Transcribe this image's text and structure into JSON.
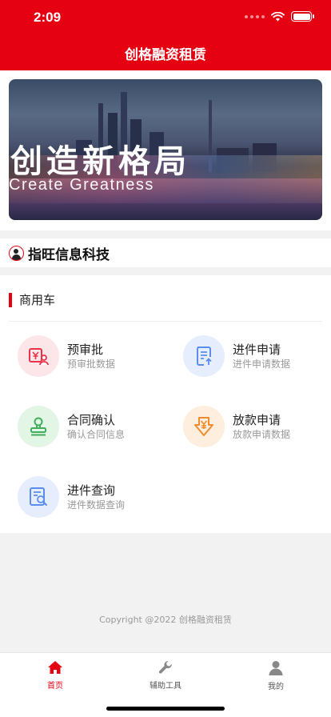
{
  "status_bar": {
    "time": "2:09"
  },
  "nav": {
    "title": "创格融资租赁"
  },
  "banner": {
    "title": "创造新格局",
    "subtitle": "Create Greatness"
  },
  "company": {
    "name": "指旺信息科技",
    "icon": "user-circle-icon"
  },
  "section": {
    "title": "商用车",
    "items": [
      {
        "title": "预审批",
        "subtitle": "预审批数据",
        "icon": "yuan-person-icon",
        "color": "#e8334a",
        "bg": "#fde6e8"
      },
      {
        "title": "进件申请",
        "subtitle": "进件申请数据",
        "icon": "document-upload-icon",
        "color": "#5b8dee",
        "bg": "#e6eefd"
      },
      {
        "title": "合同确认",
        "subtitle": "确认合同信息",
        "icon": "stamp-icon",
        "color": "#3fae58",
        "bg": "#e3f6e6"
      },
      {
        "title": "放款申请",
        "subtitle": "放款申请数据",
        "icon": "yuan-download-icon",
        "color": "#f08c2e",
        "bg": "#fdeede"
      },
      {
        "title": "进件查询",
        "subtitle": "进件数据查询",
        "icon": "document-search-icon",
        "color": "#5b8dee",
        "bg": "#e6eefd"
      }
    ]
  },
  "footer": {
    "copyright": "Copyright @2022 创格融资租赁"
  },
  "tabs": [
    {
      "label": "首页",
      "icon": "home-icon",
      "active": true
    },
    {
      "label": "辅助工具",
      "icon": "wrench-icon",
      "active": false
    },
    {
      "label": "我的",
      "icon": "person-icon",
      "active": false
    }
  ],
  "colors": {
    "brand": "#e50012",
    "page_bg": "#f2f2f2"
  }
}
